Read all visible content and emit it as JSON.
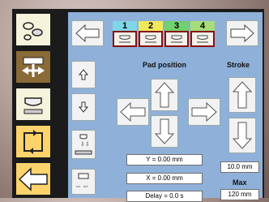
{
  "tabs": [
    {
      "num": "1",
      "color": "#7fd6e6"
    },
    {
      "num": "2",
      "color": "#f0ea5a"
    },
    {
      "num": "3",
      "color": "#6fd16f"
    },
    {
      "num": "4",
      "color": "#a7dd7a"
    }
  ],
  "labels": {
    "pad_position": "Pad position",
    "stroke": "Stroke",
    "max": "Max"
  },
  "fields": {
    "y": "Y = 0.00 mm",
    "x": "X = 0.00 mm",
    "delay": "Delay = 0.0 s",
    "stroke_value": "10.0 mm",
    "max_value": "120 mm"
  },
  "icons": {
    "sidebar": [
      "footprints-icon",
      "pad-move-icon",
      "pad-stamp-icon",
      "rotate-cycle-icon",
      "back-arrow-icon"
    ],
    "nav": [
      "arrow-left-icon",
      "arrow-right-icon",
      "arrow-up-icon",
      "arrow-down-icon",
      "arrow-left-icon",
      "arrow-right-icon"
    ]
  },
  "colors": {
    "panel": "#8fb0d8",
    "tab_border": "#8a1010",
    "sidebar_gold": "#ffd36b"
  }
}
